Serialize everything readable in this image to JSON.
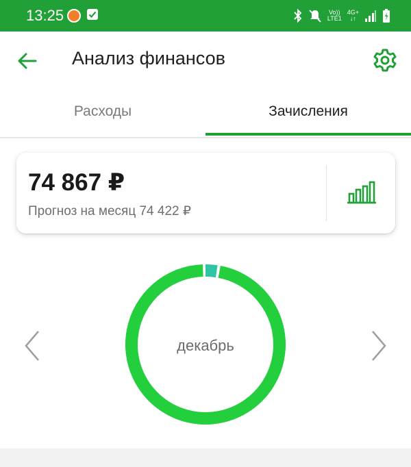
{
  "status_bar": {
    "time": "13:25",
    "network_top": "Vo))",
    "network_bottom": "LTE1",
    "gen_label": "4G+",
    "icons": [
      "app-notification-icon",
      "checkbox-icon",
      "bluetooth-icon",
      "mute-icon",
      "signal-icon",
      "battery-icon"
    ]
  },
  "app_bar": {
    "title": "Анализ финансов",
    "back_icon": "arrow-left-icon",
    "settings_icon": "gear-icon"
  },
  "tabs": [
    {
      "label": "Расходы",
      "active": false
    },
    {
      "label": "Зачисления",
      "active": true
    }
  ],
  "summary": {
    "total": "74 867 ₽",
    "forecast": "Прогноз на месяц 74 422 ₽",
    "chart_button_icon": "bar-chart-icon"
  },
  "donut": {
    "month": "декабрь",
    "segments": [
      {
        "share": 0.97,
        "color": "#23cf3c"
      },
      {
        "share": 0.03,
        "color": "#2ec4a4"
      }
    ]
  },
  "colors": {
    "brand_green": "#21a038",
    "donut_green": "#23cf3c",
    "donut_teal": "#2ec4a4"
  }
}
